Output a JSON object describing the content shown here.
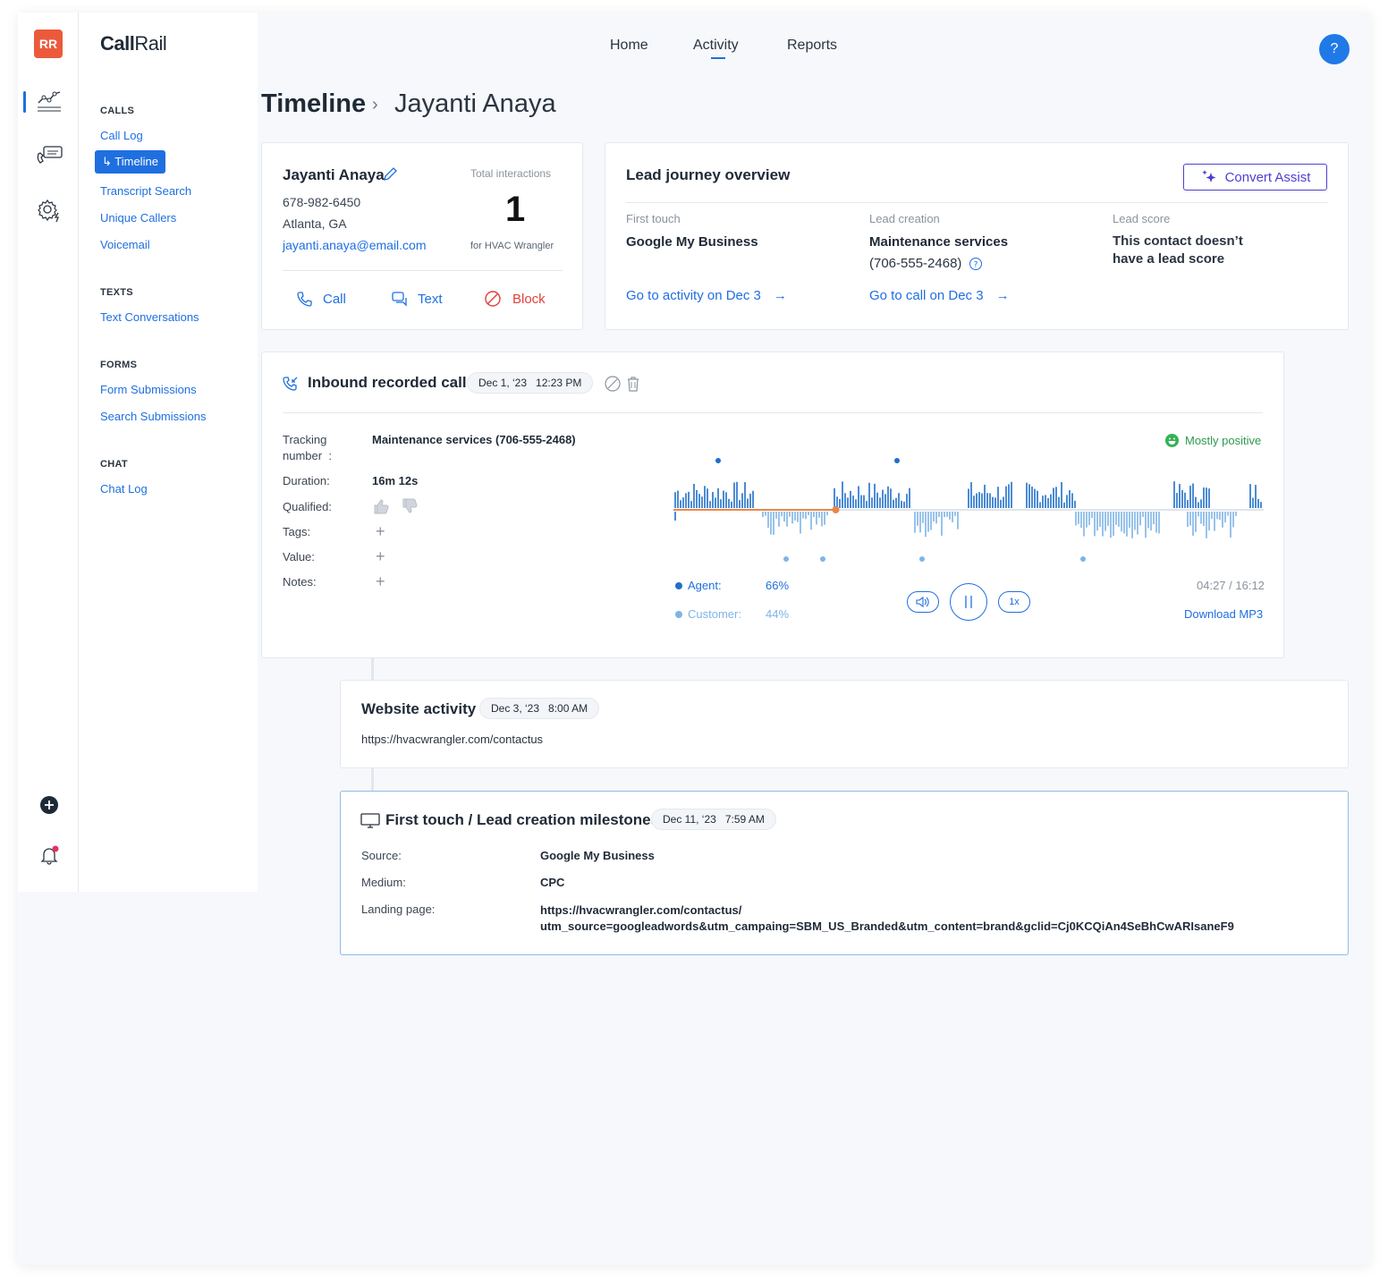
{
  "app": {
    "logo_bold": "Call",
    "logo_rest": "Rail",
    "avatar_initials": "RR",
    "help_label": "?"
  },
  "topnav": {
    "items": [
      "Home",
      "Activity",
      "Reports"
    ],
    "active": "Activity"
  },
  "sidebar": {
    "sections": [
      {
        "title": "CALLS",
        "items": [
          "Call Log",
          "Timeline",
          "Transcript Search",
          "Unique Callers",
          "Voicemail"
        ]
      },
      {
        "title": "TEXTS",
        "items": [
          "Text Conversations"
        ]
      },
      {
        "title": "FORMS",
        "items": [
          "Form Submissions",
          "Search Submissions"
        ]
      },
      {
        "title": "CHAT",
        "items": [
          "Chat Log"
        ]
      }
    ],
    "active_item": "Timeline"
  },
  "page": {
    "title": "Timeline",
    "breadcrumb_name": "Jayanti Anaya"
  },
  "contact": {
    "name": "Jayanti Anaya",
    "phone": "678-982-6450",
    "location": "Atlanta, GA",
    "email": "jayanti.anaya@email.com",
    "interactions_label": "Total interactions",
    "interactions_count": "1",
    "interactions_for": "for HVAC Wrangler",
    "actions": {
      "call": "Call",
      "text": "Text",
      "block": "Block"
    }
  },
  "journey": {
    "title": "Lead journey overview",
    "assist_button": "Convert Assist",
    "first_touch": {
      "label": "First touch",
      "value": "Google My Business",
      "link": "Go to activity on Dec 3"
    },
    "lead_creation": {
      "label": "Lead creation",
      "value": "Maintenance services",
      "number": "(706-555-2468)",
      "link": "Go to call on Dec 3"
    },
    "lead_score": {
      "label": "Lead score",
      "value": "This contact doesn’t have a lead score"
    }
  },
  "call": {
    "title": "Inbound recorded call",
    "date": "Dec 1, ‘23",
    "time": "12:23 PM",
    "tracking_label": "Tracking number",
    "tracking_colon": ":",
    "tracking_value": "Maintenance services (706-555-2468)",
    "duration_label": "Duration:",
    "duration_value": "16m 12s",
    "qualified_label": "Qualified:",
    "tags_label": "Tags:",
    "value_label": "Value:",
    "notes_label": "Notes:",
    "sentiment": "Mostly positive",
    "agent_label": "Agent:",
    "agent_pct": "66%",
    "customer_label": "Customer:",
    "customer_pct": "44%",
    "playback_position": "04:27 / 16:12",
    "progress": 0.275,
    "speed": "1x",
    "download": "Download MP3"
  },
  "website": {
    "title": "Website activity",
    "date": "Dec 3, ‘23",
    "time": "8:00 AM",
    "url": "https://hvacwrangler.com/contactus"
  },
  "milestone": {
    "title": "First touch / Lead creation milestones",
    "date": "Dec 11, ‘23",
    "time": "7:59 AM",
    "source_label": "Source:",
    "source_value": "Google My Business",
    "medium_label": "Medium:",
    "medium_value": "CPC",
    "landing_label": "Landing page:",
    "landing_line1": "https://hvacwrangler.com/contactus/",
    "landing_line2": "utm_source=googleadwords&utm_campaing=SBM_US_Branded&utm_content=brand&gclid=Cj0KCQiAn4SeBhCwARIsaneF9"
  },
  "colors": {
    "accent": "#1f6fe0",
    "brand": "#ec5a3c",
    "assist": "#4c3fd1",
    "block": "#e0413a",
    "positive": "#2e9a4e",
    "agent_wave": "#1f6fc9",
    "customer_wave": "#7fb4e6",
    "progress": "#e8874a"
  }
}
